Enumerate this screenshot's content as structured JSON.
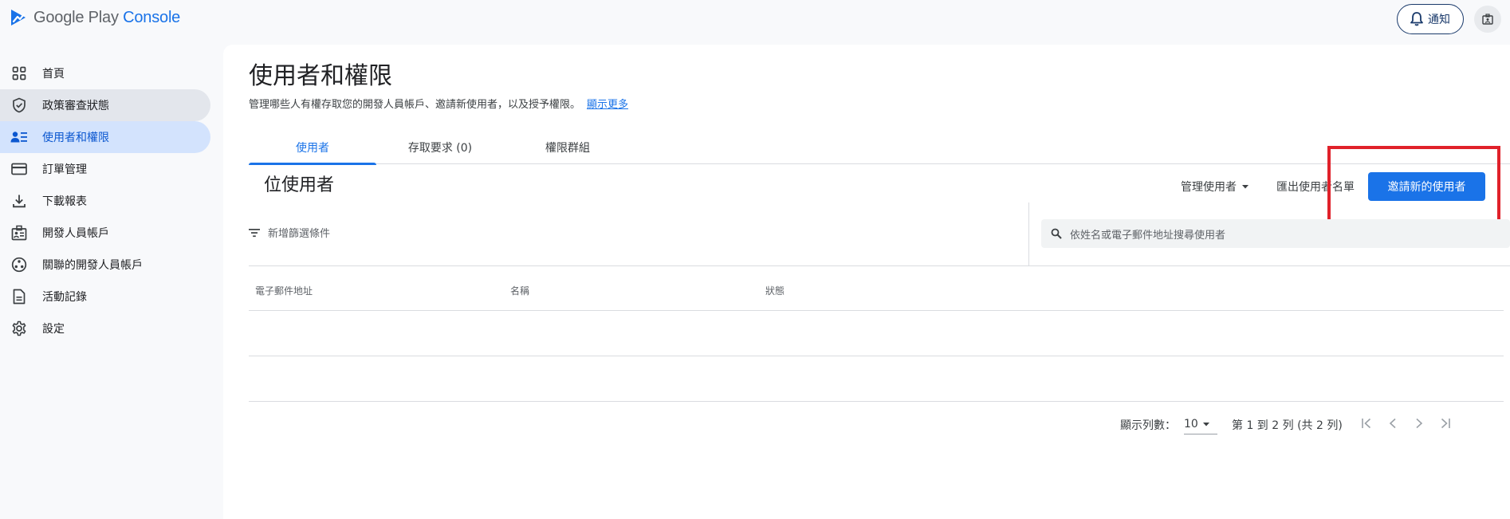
{
  "app": {
    "logo_primary": "Google Play",
    "logo_accent": "Console",
    "notify_label": "通知"
  },
  "sidebar": {
    "items": [
      {
        "label": "首頁",
        "icon": "dashboard-grid-icon"
      },
      {
        "label": "政策審查狀態",
        "icon": "shield-check-icon"
      },
      {
        "label": "使用者和權限",
        "icon": "users-list-icon"
      },
      {
        "label": "訂單管理",
        "icon": "credit-card-icon"
      },
      {
        "label": "下載報表",
        "icon": "download-icon"
      },
      {
        "label": "開發人員帳戶",
        "icon": "developer-badge-icon"
      },
      {
        "label": "關聯的開發人員帳戶",
        "icon": "linked-accounts-icon"
      },
      {
        "label": "活動記錄",
        "icon": "document-icon"
      },
      {
        "label": "設定",
        "icon": "gear-icon"
      }
    ]
  },
  "page": {
    "title": "使用者和權限",
    "description": "管理哪些人有權存取您的開發人員帳戶、邀請新使用者，以及授予權限。",
    "learn_more": "顯示更多"
  },
  "tabs": [
    {
      "label": "使用者"
    },
    {
      "label": "存取要求 (0)"
    },
    {
      "label": "權限群組"
    }
  ],
  "users_section": {
    "title": "位使用者",
    "manage_users": "管理使用者",
    "export_list": "匯出使用者名單",
    "invite_button": "邀請新的使用者",
    "filter_label": "新增篩選條件",
    "search_placeholder": "依姓名或電子郵件地址搜尋使用者"
  },
  "table": {
    "columns": [
      "電子郵件地址",
      "名稱",
      "狀態"
    ]
  },
  "pagination": {
    "rows_label": "顯示列數：",
    "rows_value": "10",
    "range": "第 1 到 2 列 (共 2 列)"
  },
  "colors": {
    "accent": "#1a73e8",
    "highlight": "#e0212a"
  }
}
